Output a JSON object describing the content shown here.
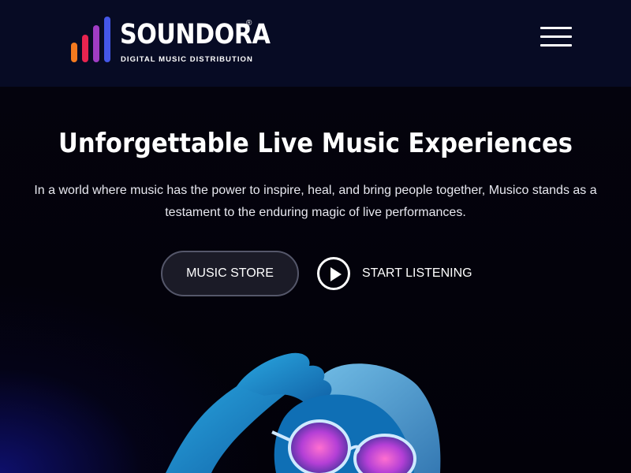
{
  "header": {
    "logo": {
      "name": "SOUNDORA",
      "registered": "®",
      "tagline": "DIGITAL MUSIC DISTRIBUTION",
      "bar_colors": [
        "#f47a1f",
        "#e8244f",
        "#a03cc4",
        "#4457e8"
      ]
    },
    "menu_icon": "hamburger-icon"
  },
  "hero": {
    "title": "Unforgettable Live Music Experiences",
    "text": "In a world where music has the power to inspire, heal, and bring people together, Musico stands as a testament to the enduring magic of live performances.",
    "store_button": "MUSIC STORE",
    "listen_button": "START LISTENING",
    "play_icon": "play-circle-icon"
  },
  "colors": {
    "header_bg": "#070b24",
    "page_bg": "#000004",
    "accent_glow": "#1b1f9e"
  }
}
